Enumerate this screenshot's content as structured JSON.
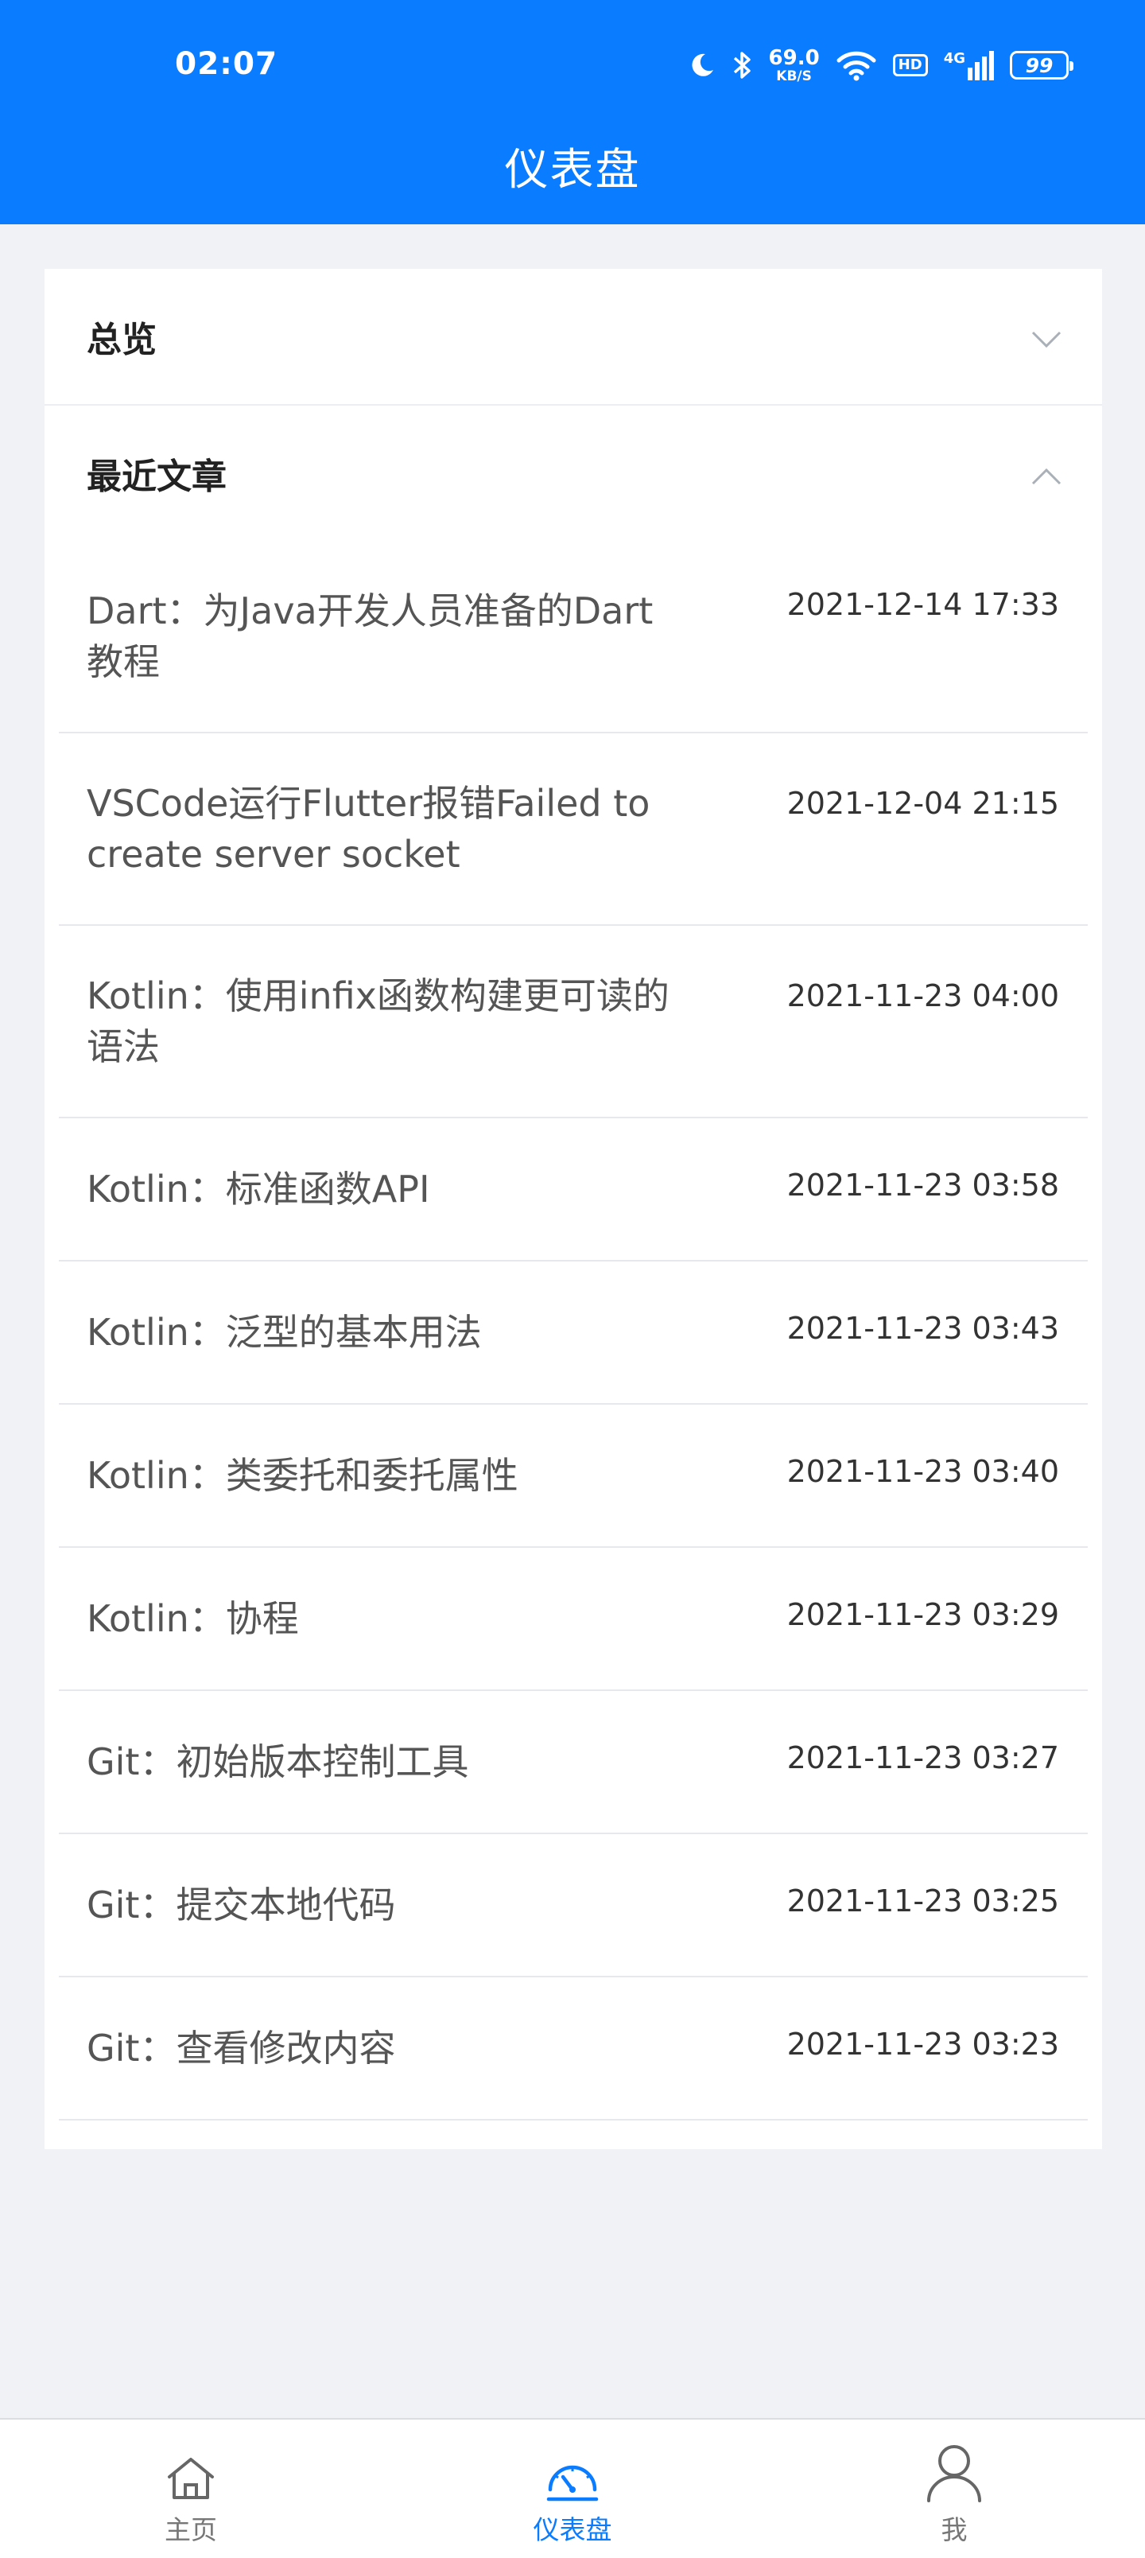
{
  "status_bar": {
    "time": "02:07",
    "net_speed_value": "69.0",
    "net_speed_unit": "KB/S",
    "hd": "HD",
    "signal": "4G",
    "battery": "99"
  },
  "header": {
    "title": "仪表盘"
  },
  "sections": {
    "overview": {
      "label": "总览",
      "expanded": false
    },
    "recent": {
      "label": "最近文章",
      "expanded": true
    }
  },
  "articles": [
    {
      "title": "Dart：为Java开发人员准备的Dart教程",
      "date": "2021-12-14 17:33"
    },
    {
      "title": "VSCode运行Flutter报错Failed to create server socket",
      "date": "2021-12-04 21:15"
    },
    {
      "title": "Kotlin：使用infix函数构建更可读的语法",
      "date": "2021-11-23 04:00"
    },
    {
      "title": "Kotlin：标准函数API",
      "date": "2021-11-23 03:58"
    },
    {
      "title": "Kotlin：泛型的基本用法",
      "date": "2021-11-23 03:43"
    },
    {
      "title": "Kotlin：类委托和委托属性",
      "date": "2021-11-23 03:40"
    },
    {
      "title": "Kotlin：协程",
      "date": "2021-11-23 03:29"
    },
    {
      "title": "Git：初始版本控制工具",
      "date": "2021-11-23 03:27"
    },
    {
      "title": "Git：提交本地代码",
      "date": "2021-11-23 03:25"
    },
    {
      "title": "Git：查看修改内容",
      "date": "2021-11-23 03:23"
    }
  ],
  "bottom_nav": {
    "home": "主页",
    "dashboard": "仪表盘",
    "me": "我",
    "active": "dashboard"
  },
  "colors": {
    "primary": "#0a7cff",
    "background": "#f1f2f6"
  }
}
